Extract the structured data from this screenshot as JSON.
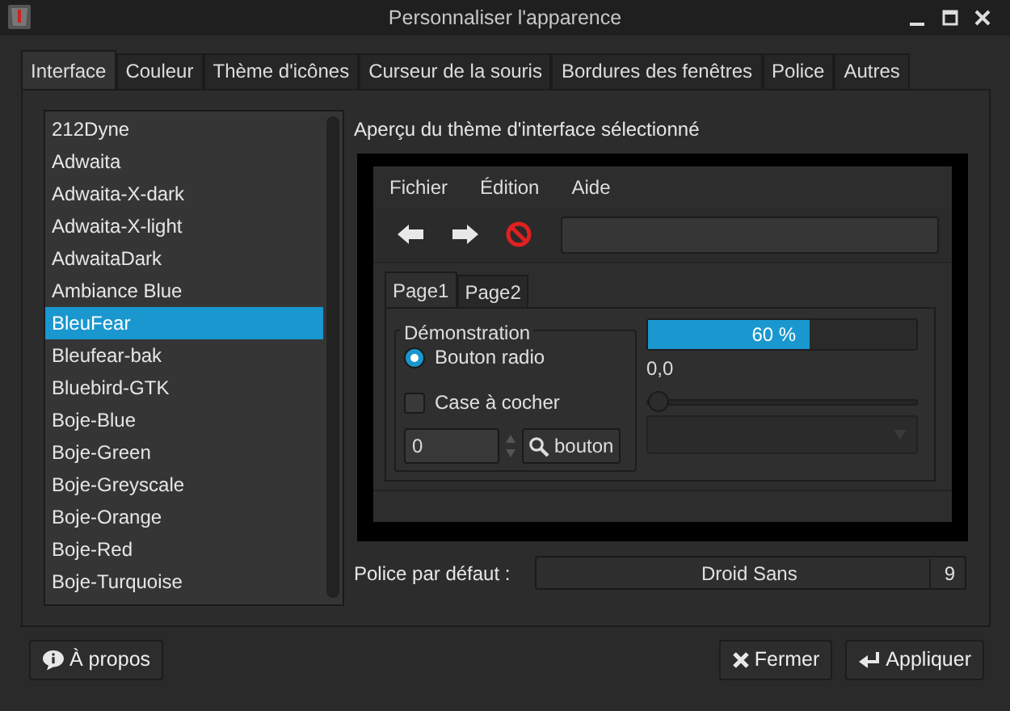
{
  "window": {
    "title": "Personnaliser l'apparence"
  },
  "tabs": [
    {
      "label": "Interface",
      "selected": true
    },
    {
      "label": "Couleur",
      "selected": false
    },
    {
      "label": "Thème d'icônes",
      "selected": false
    },
    {
      "label": "Curseur de la souris",
      "selected": false
    },
    {
      "label": "Bordures des fenêtres",
      "selected": false
    },
    {
      "label": "Police",
      "selected": false
    },
    {
      "label": "Autres",
      "selected": false
    }
  ],
  "themes": [
    {
      "name": "212Dyne",
      "selected": false
    },
    {
      "name": "Adwaita",
      "selected": false
    },
    {
      "name": "Adwaita-X-dark",
      "selected": false
    },
    {
      "name": "Adwaita-X-light",
      "selected": false
    },
    {
      "name": "AdwaitaDark",
      "selected": false
    },
    {
      "name": "Ambiance Blue",
      "selected": false
    },
    {
      "name": "BleuFear",
      "selected": true
    },
    {
      "name": "Bleufear-bak",
      "selected": false
    },
    {
      "name": "Bluebird-GTK",
      "selected": false
    },
    {
      "name": "Boje-Blue",
      "selected": false
    },
    {
      "name": "Boje-Green",
      "selected": false
    },
    {
      "name": "Boje-Greyscale",
      "selected": false
    },
    {
      "name": "Boje-Orange",
      "selected": false
    },
    {
      "name": "Boje-Red",
      "selected": false
    },
    {
      "name": "Boje-Turquoise",
      "selected": false
    }
  ],
  "preview": {
    "heading": "Aperçu du thème d'interface sélectionné",
    "menu": [
      "Fichier",
      "Édition",
      "Aide"
    ],
    "tabs": [
      {
        "label": "Page1",
        "selected": true
      },
      {
        "label": "Page2",
        "selected": false
      }
    ],
    "group": {
      "title": "Démonstration",
      "radio": {
        "label": "Bouton radio",
        "checked": true
      },
      "checkbox": {
        "label": "Case à cocher",
        "checked": false
      },
      "spin_value": "0",
      "button": "bouton"
    },
    "progress": {
      "level": 0.6,
      "text": "60 %"
    },
    "slider": {
      "reading": "0,0",
      "level": 0
    }
  },
  "font": {
    "label": "Police par défaut :",
    "name": "Droid Sans",
    "size": "9"
  },
  "buttons": [
    {
      "label": "À propos",
      "kind": "about"
    },
    {
      "label": "Fermer",
      "kind": "close"
    },
    {
      "label": "Appliquer",
      "kind": "apply"
    }
  ]
}
